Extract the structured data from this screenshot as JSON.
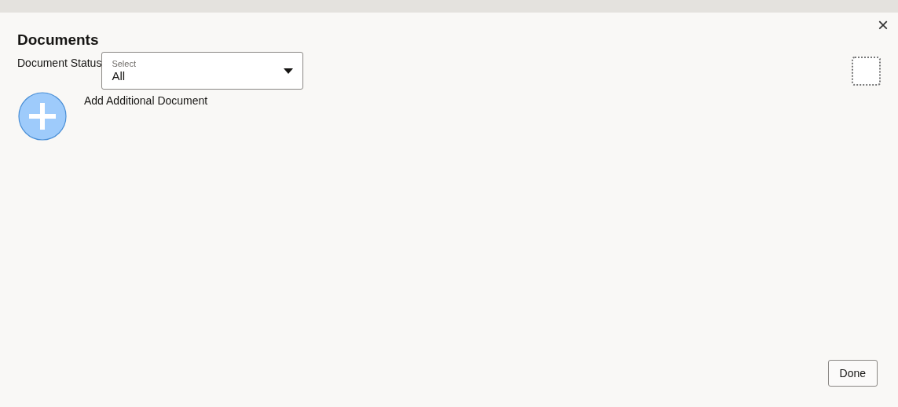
{
  "dialog": {
    "title": "Documents",
    "close": "×"
  },
  "filter": {
    "label": "Document Status",
    "select": {
      "placeholder": "Select",
      "value": "All"
    }
  },
  "toggle": {
    "checked": false
  },
  "add_action": {
    "label": "Add Additional Document"
  },
  "buttons": [
    "Done"
  ]
}
